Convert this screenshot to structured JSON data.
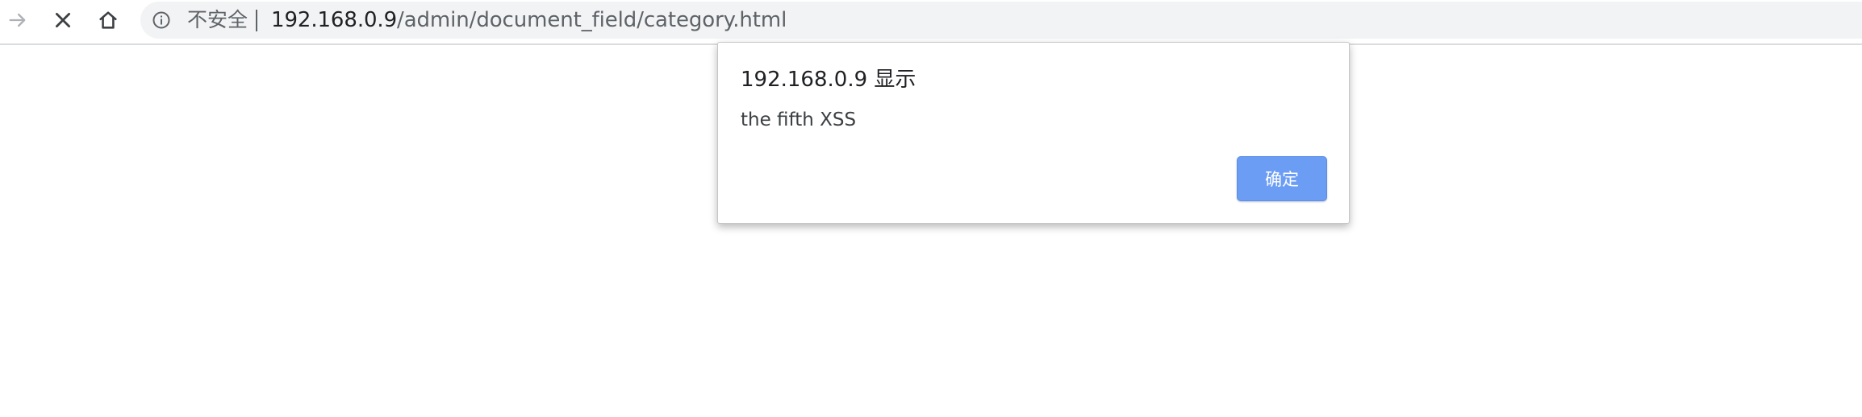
{
  "browser": {
    "security_label": "不安全",
    "url_host": "192.168.0.9",
    "url_path": "/admin/document_field/category.html",
    "icons": {
      "forward": "arrow-forward-icon",
      "stop": "close-icon",
      "home": "home-icon",
      "info": "info-icon"
    }
  },
  "dialog": {
    "title": "192.168.0.9 显示",
    "message": "the fifth XSS",
    "ok_label": "确定",
    "ok_color": "#6c9df5"
  }
}
